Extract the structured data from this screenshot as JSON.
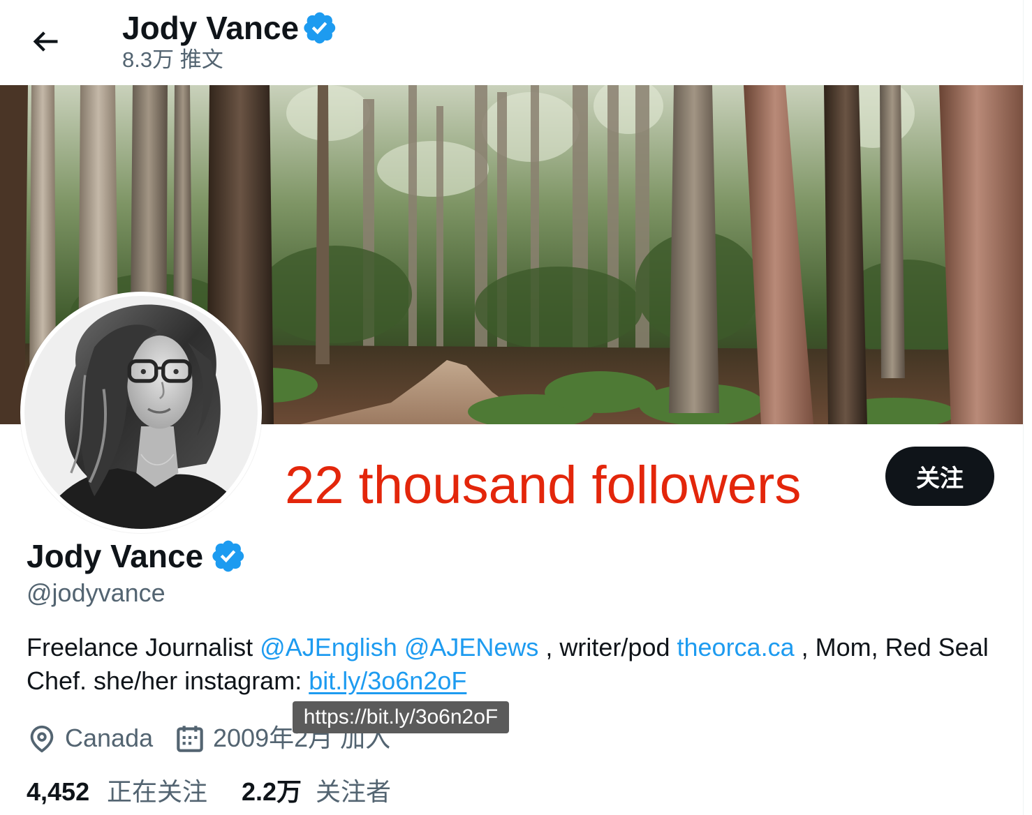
{
  "header": {
    "name": "Jody Vance",
    "tweet_count": "8.3万 推文"
  },
  "annotation": {
    "text": "22 thousand followers"
  },
  "follow_button": {
    "label": "关注"
  },
  "profile": {
    "name": "Jody Vance",
    "handle": "@jodyvance",
    "bio": {
      "text_1": "Freelance Journalist ",
      "mention_1": "@AJEnglish",
      "text_2": " ",
      "mention_2": "@AJENews",
      "text_3": " , writer/pod ",
      "link_1": "theorca.ca",
      "text_4": " , Mom, Red Seal",
      "text_5": "Chef. she/her instagram: ",
      "link_2": "bit.ly/3o6n2oF"
    },
    "link_tooltip": "https://bit.ly/3o6n2oF",
    "location": "Canada",
    "joined": "2009年2月 加入",
    "following": {
      "count": "4,452",
      "label": "正在关注"
    },
    "followers": {
      "count": "2.2万",
      "label": "关注者"
    }
  },
  "icons": {
    "back": "arrow-left-icon",
    "verified": "verified-badge-icon",
    "location": "location-pin-icon",
    "joined": "calendar-icon"
  },
  "colors": {
    "text": "#0f1419",
    "secondary": "#536471",
    "link": "#1d9bf0",
    "verified": "#1d9bf0",
    "annotation": "#e3260b",
    "button_bg": "#0f1419",
    "button_text": "#ffffff",
    "tooltip_bg": "#5b5b5b"
  }
}
